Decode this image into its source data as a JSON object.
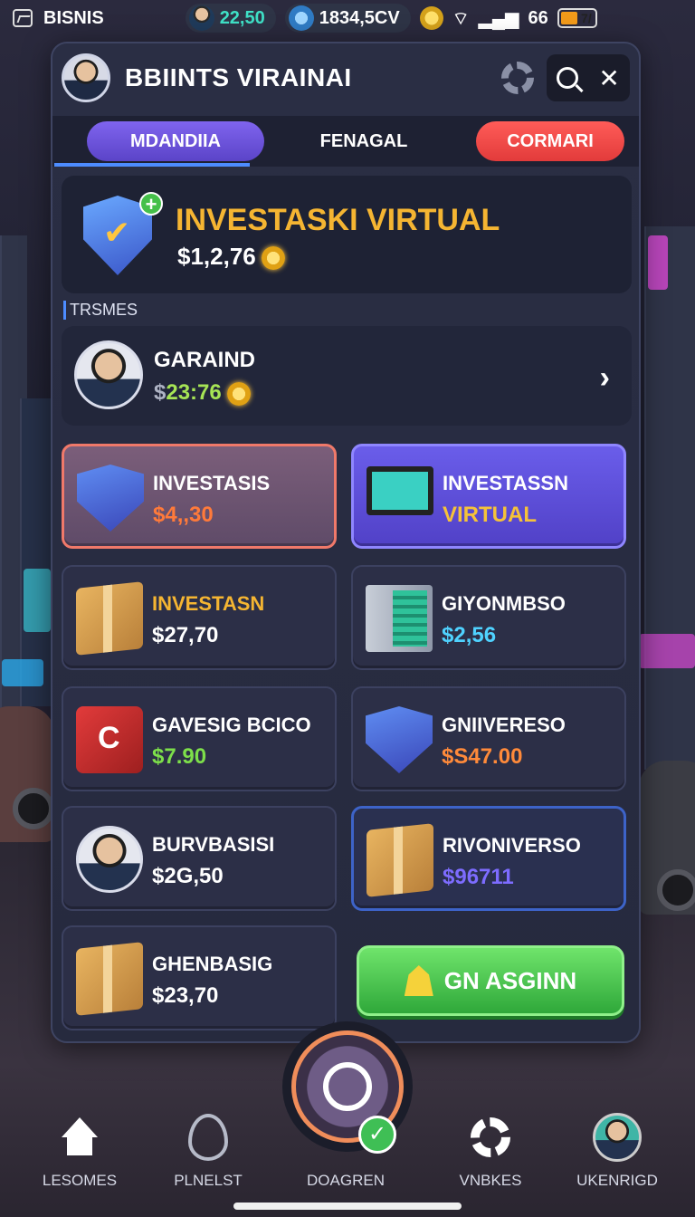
{
  "status_bar": {
    "brand": "BISNIS",
    "balance": "22,50",
    "gems": "1834,5CV",
    "battery_label": "66",
    "battery_pct": "7/"
  },
  "header": {
    "title": "BBIINTS VIRAINAI"
  },
  "tabs": [
    {
      "label": "MDANDIIA",
      "active": true
    },
    {
      "label": "FENAGAL",
      "active": false
    },
    {
      "label": "CORMARI",
      "active": false
    }
  ],
  "hero": {
    "title": "INVESTASKI VIRTUAL",
    "value": "$1,2,76"
  },
  "section_label": "TRSMES",
  "player": {
    "name": "GARAIND",
    "currency": "$",
    "amount": "23:76"
  },
  "cards": [
    {
      "name": "INVESTASIS",
      "value": "$4,,30",
      "name_color": "#ffffff",
      "value_color": "#ff7a3a",
      "icon": "clock-shield-icon"
    },
    {
      "name": "INVESTASSN",
      "value": "VIRTUAL",
      "name_color": "#ffffff",
      "value_color": "#f5c23a",
      "icon": "laptop-icon"
    },
    {
      "name": "INVESTASN",
      "value": "$27,70",
      "name_color": "#f5b532",
      "value_color": "#ffffff",
      "icon": "box-icon"
    },
    {
      "name": "GIYONMBSO",
      "value": "$2,56",
      "name_color": "#ffffff",
      "value_color": "#4fd2ff",
      "icon": "server-icon"
    },
    {
      "name": "GAVESIG BCICO",
      "value": "$7.90",
      "name_color": "#ffffff",
      "value_color": "#7ddf4a",
      "icon": "red-cube-icon"
    },
    {
      "name": "GNIIVERESO",
      "value": "$S47.00",
      "name_color": "#ffffff",
      "value_color": "#ff8a3a",
      "icon": "shield-icon"
    },
    {
      "name": "BURVBASISI",
      "value": "$2G,50",
      "name_color": "#ffffff",
      "value_color": "#ffffff",
      "icon": "avatar-icon"
    },
    {
      "name": "RIVONIVERSO",
      "value": "$96711",
      "name_color": "#ffffff",
      "value_color": "#7d6cff",
      "icon": "box-icon"
    },
    {
      "name": "GHENBASIG",
      "value": "$23,70",
      "name_color": "#ffffff",
      "value_color": "#ffffff",
      "icon": "box-icon"
    }
  ],
  "go_button": {
    "label": "GN ASGINN"
  },
  "nav": [
    {
      "label": "LESOMES",
      "icon": "home-icon"
    },
    {
      "label": "PLNELST",
      "icon": "pin-icon"
    },
    {
      "label": "DOAGREN",
      "icon": "center-action-icon"
    },
    {
      "label": "VNBKES",
      "icon": "gear-icon"
    },
    {
      "label": "UKENRIGD",
      "icon": "profile-icon"
    }
  ]
}
